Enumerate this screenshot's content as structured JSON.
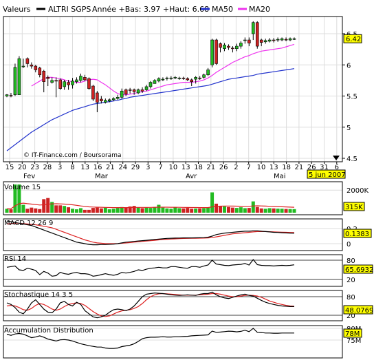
{
  "header": {
    "label": "Valeurs",
    "series_name": "ALTRI SGPS",
    "stats": "Année +Bas: 3.97 +Haut: 6.68",
    "ma50_label": "MA50",
    "ma20_label": "MA20"
  },
  "colors": {
    "background": "#ffffff",
    "axis": "#000000",
    "grid": "#dcdcdc",
    "candle_up": "#22bb22",
    "candle_down": "#cc2222",
    "candle_outline": "#000000",
    "ma50": "#2233cc",
    "ma20": "#ee33ee",
    "label_box": "#ffff00",
    "signal_line": "#dd2222",
    "indicator_line": "#000000"
  },
  "credit": "© IT-Finance.com / Boursorama",
  "date_axis": {
    "tick_labels": [
      "15",
      "20",
      "23",
      "28",
      "3",
      "8",
      "13",
      "16",
      "21",
      "24",
      "29",
      "3",
      "7",
      "10",
      "13",
      "18",
      "21",
      "26",
      "2",
      "7",
      "10",
      "13",
      "18",
      "21",
      "26",
      "31",
      "6"
    ],
    "month_labels": [
      "Fev",
      "Mar",
      "Avr",
      "Mai"
    ],
    "current_date": "5 jun 2007"
  },
  "chart_data": [
    {
      "type": "candlestick",
      "title": "ALTRI SGPS",
      "y_ticks": [
        "6.5",
        "6",
        "5.5",
        "5",
        "4.5"
      ],
      "ylim": [
        4.45,
        6.8
      ],
      "last_value": "6.42",
      "dates": [
        "15/01",
        "16/01",
        "17/01",
        "18/01",
        "19/01",
        "22/01",
        "23/01",
        "24/01",
        "25/01",
        "26/01",
        "29/01",
        "30/01",
        "31/01",
        "01/02",
        "02/02",
        "05/02",
        "06/02",
        "07/02",
        "08/02",
        "09/02",
        "12/02",
        "13/02",
        "14/02",
        "15/02",
        "16/02",
        "19/02",
        "20/02",
        "21/02",
        "22/02",
        "23/02",
        "26/02",
        "27/02",
        "28/02",
        "01/03",
        "02/03",
        "05/03",
        "06/03",
        "07/03",
        "08/03",
        "09/03",
        "12/03",
        "13/03",
        "14/03",
        "15/03",
        "16/03",
        "19/03",
        "20/03",
        "21/03",
        "22/03",
        "23/03",
        "26/03",
        "27/03",
        "28/03",
        "29/03",
        "30/03",
        "02/04",
        "03/04",
        "04/04",
        "05/04",
        "06/04",
        "09/04",
        "10/04",
        "11/04",
        "12/04",
        "13/04",
        "16/04",
        "17/04",
        "18/04",
        "19/04",
        "20/04",
        "23/04",
        "24/04",
        "25/04",
        "26/04",
        "27/04",
        "30/04",
        "01/05",
        "02/05",
        "03/05",
        "04/05",
        "07/05",
        "08/05",
        "09/05",
        "10/05",
        "11/05",
        "14/05",
        "15/05",
        "16/05",
        "17/05",
        "18/05",
        "21/05",
        "22/05",
        "23/05"
      ],
      "open": [
        5.5,
        5.51,
        5.52,
        5.52,
        5.98,
        6.1,
        6.0,
        5.98,
        5.95,
        5.9,
        5.8,
        5.72,
        5.75,
        5.76,
        5.65,
        5.72,
        5.68,
        5.73,
        5.75,
        5.8,
        5.78,
        5.66,
        5.55,
        5.45,
        5.4,
        5.42,
        5.44,
        5.46,
        5.48,
        5.6,
        5.6,
        5.6,
        5.55,
        5.6,
        5.6,
        5.65,
        5.7,
        5.74,
        5.76,
        5.78,
        5.78,
        5.79,
        5.78,
        5.79,
        5.78,
        5.76,
        5.77,
        5.79,
        5.8,
        5.84,
        6.0,
        6.4,
        6.34,
        6.26,
        6.3,
        6.27,
        6.26,
        6.3,
        6.4,
        6.4,
        6.5,
        6.68,
        6.4,
        6.37,
        6.38,
        6.4,
        6.4,
        6.4,
        6.41,
        6.4,
        6.42
      ],
      "close": [
        5.52,
        5.5,
        5.96,
        6.1,
        5.98,
        6.02,
        5.98,
        5.92,
        5.84,
        5.73,
        5.78,
        5.75,
        5.74,
        5.62,
        5.73,
        5.68,
        5.74,
        5.76,
        5.82,
        5.76,
        5.62,
        5.45,
        5.4,
        5.42,
        5.43,
        5.44,
        5.46,
        5.48,
        5.58,
        5.53,
        5.59,
        5.57,
        5.6,
        5.58,
        5.65,
        5.72,
        5.75,
        5.78,
        5.77,
        5.79,
        5.79,
        5.8,
        5.79,
        5.78,
        5.76,
        5.73,
        5.8,
        5.78,
        5.84,
        5.92,
        6.4,
        6.02,
        6.28,
        6.32,
        6.28,
        6.26,
        6.3,
        6.35,
        6.4,
        6.35,
        6.68,
        6.3,
        6.36,
        6.39,
        6.4,
        6.39,
        6.41,
        6.42,
        6.4,
        6.42,
        6.42
      ],
      "high": [
        5.53,
        5.55,
        6.02,
        6.14,
        6.1,
        6.12,
        6.04,
        6.0,
        5.97,
        5.92,
        5.83,
        5.8,
        5.8,
        5.78,
        5.76,
        5.76,
        5.79,
        5.8,
        5.86,
        5.84,
        5.8,
        5.68,
        5.58,
        5.5,
        5.46,
        5.46,
        5.48,
        5.52,
        5.62,
        5.62,
        5.63,
        5.62,
        5.62,
        5.64,
        5.68,
        5.74,
        5.77,
        5.8,
        5.8,
        5.81,
        5.82,
        5.82,
        5.81,
        5.81,
        5.8,
        5.78,
        5.82,
        5.82,
        5.86,
        5.95,
        6.42,
        6.42,
        6.36,
        6.35,
        6.33,
        6.3,
        6.34,
        6.38,
        6.44,
        6.44,
        6.7,
        6.7,
        6.42,
        6.42,
        6.43,
        6.43,
        6.44,
        6.44,
        6.44,
        6.44,
        6.44
      ],
      "low": [
        5.48,
        5.48,
        5.5,
        5.92,
        5.95,
        5.96,
        5.94,
        5.88,
        5.8,
        5.56,
        5.66,
        5.7,
        5.48,
        5.6,
        5.6,
        5.6,
        5.62,
        5.7,
        5.72,
        5.74,
        5.6,
        5.42,
        5.24,
        5.38,
        5.38,
        5.4,
        5.42,
        5.44,
        5.46,
        5.5,
        5.54,
        5.52,
        5.53,
        5.55,
        5.58,
        5.62,
        5.7,
        5.72,
        5.74,
        5.75,
        5.76,
        5.77,
        5.76,
        5.76,
        5.74,
        5.66,
        5.7,
        5.76,
        5.78,
        5.82,
        5.96,
        6.0,
        6.2,
        6.22,
        6.24,
        6.2,
        6.22,
        6.26,
        6.34,
        6.3,
        6.4,
        6.26,
        6.3,
        6.34,
        6.36,
        6.36,
        6.37,
        6.38,
        6.38,
        6.38,
        6.4
      ],
      "ma50": [
        4.62,
        4.67,
        4.72,
        4.77,
        4.82,
        4.87,
        4.92,
        4.96,
        5.0,
        5.04,
        5.08,
        5.12,
        5.15,
        5.18,
        5.21,
        5.24,
        5.27,
        5.29,
        5.31,
        5.33,
        5.35,
        5.37,
        5.38,
        5.39,
        5.4,
        5.41,
        5.42,
        5.43,
        5.45,
        5.46,
        5.48,
        5.49,
        5.5,
        5.51,
        5.52,
        5.53,
        5.54,
        5.55,
        5.56,
        5.57,
        5.58,
        5.59,
        5.6,
        5.61,
        5.62,
        5.63,
        5.64,
        5.65,
        5.66,
        5.67,
        5.69,
        5.71,
        5.73,
        5.75,
        5.77,
        5.78,
        5.79,
        5.8,
        5.81,
        5.82,
        5.83,
        5.85,
        5.86,
        5.87,
        5.88,
        5.89,
        5.9,
        5.91,
        5.92,
        5.93,
        5.94
      ],
      "ma20": [
        null,
        null,
        null,
        null,
        null,
        null,
        5.66,
        5.7,
        5.74,
        5.78,
        5.8,
        5.8,
        5.79,
        5.78,
        5.76,
        5.74,
        5.73,
        5.72,
        5.72,
        5.74,
        5.76,
        5.77,
        5.76,
        5.72,
        5.68,
        5.63,
        5.58,
        5.54,
        5.52,
        5.52,
        5.53,
        5.54,
        5.56,
        5.57,
        5.58,
        5.6,
        5.62,
        5.64,
        5.66,
        5.68,
        5.69,
        5.7,
        5.71,
        5.72,
        5.72,
        5.72,
        5.73,
        5.74,
        5.76,
        5.79,
        5.83,
        5.88,
        5.92,
        5.96,
        6.0,
        6.04,
        6.07,
        6.1,
        6.13,
        6.15,
        6.18,
        6.2,
        6.22,
        6.23,
        6.24,
        6.25,
        6.26,
        6.27,
        6.29,
        6.31,
        6.33
      ]
    },
    {
      "type": "bar",
      "title": "Volume 15",
      "y_ticks": [
        "2000K"
      ],
      "last_value": "315K",
      "ylim": [
        0,
        2500
      ],
      "values": [
        350,
        300,
        2500,
        2500,
        700,
        350,
        450,
        380,
        320,
        1200,
        1300,
        950,
        650,
        650,
        600,
        480,
        350,
        300,
        400,
        250,
        250,
        420,
        450,
        380,
        450,
        300,
        350,
        420,
        500,
        450,
        550,
        600,
        450,
        400,
        450,
        420,
        500,
        700,
        450,
        380,
        350,
        480,
        400,
        380,
        420,
        350,
        370,
        380,
        400,
        450,
        1800,
        800,
        600,
        550,
        500,
        450,
        420,
        480,
        400,
        420,
        1000,
        500,
        380,
        350,
        400,
        380,
        360,
        350,
        330,
        320,
        315
      ],
      "ma": [
        350,
        360,
        600,
        800,
        850,
        800,
        760,
        720,
        680,
        700,
        750,
        780,
        790,
        780,
        760,
        740,
        700,
        650,
        600,
        560,
        520,
        500,
        490,
        480,
        470,
        460,
        450,
        450,
        450,
        450,
        460,
        470,
        470,
        470,
        470,
        470,
        480,
        490,
        490,
        490,
        480,
        480,
        475,
        470,
        465,
        460,
        455,
        450,
        450,
        450,
        520,
        560,
        580,
        590,
        590,
        585,
        580,
        575,
        570,
        570,
        600,
        610,
        600,
        585,
        570,
        555,
        540,
        525,
        510,
        495,
        480
      ]
    },
    {
      "type": "line",
      "title": "MACD 12 26 9",
      "y_ticks": [
        "0.2",
        "0"
      ],
      "last_value": "0.1383",
      "ylim": [
        -0.05,
        0.3
      ],
      "macd": [
        0.3,
        0.29,
        0.28,
        0.27,
        0.26,
        0.25,
        0.24,
        0.22,
        0.2,
        0.18,
        0.16,
        0.14,
        0.12,
        0.1,
        0.08,
        0.06,
        0.04,
        0.02,
        0.01,
        0.0,
        -0.01,
        -0.015,
        -0.015,
        -0.012,
        -0.01,
        -0.008,
        -0.005,
        0.0,
        0.01,
        0.02,
        0.025,
        0.03,
        0.035,
        0.04,
        0.045,
        0.05,
        0.055,
        0.06,
        0.065,
        0.07,
        0.072,
        0.074,
        0.075,
        0.076,
        0.076,
        0.076,
        0.077,
        0.078,
        0.08,
        0.085,
        0.1,
        0.12,
        0.13,
        0.14,
        0.145,
        0.15,
        0.155,
        0.16,
        0.165,
        0.165,
        0.17,
        0.17,
        0.165,
        0.16,
        0.155,
        0.15,
        0.148,
        0.145,
        0.142,
        0.14,
        0.1383
      ],
      "signal": [
        0.26,
        0.265,
        0.27,
        0.27,
        0.265,
        0.26,
        0.255,
        0.25,
        0.24,
        0.23,
        0.22,
        0.21,
        0.19,
        0.17,
        0.15,
        0.13,
        0.11,
        0.09,
        0.07,
        0.05,
        0.035,
        0.02,
        0.01,
        0.005,
        0.0,
        0.0,
        0.0,
        0.002,
        0.005,
        0.01,
        0.015,
        0.02,
        0.025,
        0.03,
        0.035,
        0.04,
        0.045,
        0.05,
        0.055,
        0.058,
        0.061,
        0.064,
        0.067,
        0.069,
        0.07,
        0.071,
        0.072,
        0.073,
        0.074,
        0.076,
        0.08,
        0.09,
        0.1,
        0.11,
        0.12,
        0.13,
        0.135,
        0.14,
        0.145,
        0.15,
        0.155,
        0.16,
        0.16,
        0.16,
        0.158,
        0.156,
        0.154,
        0.152,
        0.15,
        0.148,
        0.146
      ]
    },
    {
      "type": "line",
      "title": "RSI 14",
      "y_ticks": [
        "80",
        "20"
      ],
      "last_value": "65.6932",
      "ylim": [
        0,
        100
      ],
      "values": [
        58,
        60,
        62,
        50,
        48,
        55,
        52,
        48,
        35,
        45,
        40,
        30,
        32,
        42,
        38,
        36,
        40,
        42,
        38,
        38,
        36,
        30,
        32,
        35,
        38,
        35,
        33,
        36,
        42,
        40,
        42,
        45,
        50,
        48,
        52,
        55,
        56,
        58,
        56,
        56,
        60,
        60,
        58,
        56,
        55,
        60,
        60,
        58,
        62,
        65,
        80,
        68,
        66,
        64,
        63,
        65,
        66,
        67,
        70,
        65,
        82,
        66,
        64,
        63,
        63,
        62,
        63,
        64,
        63,
        64,
        65.7
      ],
      "levels": [
        80,
        20
      ]
    },
    {
      "type": "line",
      "title": "Stochastique 14 3 5",
      "y_ticks": [
        "80",
        "20"
      ],
      "last_value": "48.0769",
      "ylim": [
        0,
        100
      ],
      "k": [
        60,
        55,
        45,
        30,
        25,
        40,
        60,
        70,
        55,
        40,
        30,
        28,
        40,
        60,
        65,
        55,
        50,
        62,
        55,
        35,
        25,
        15,
        12,
        15,
        20,
        30,
        38,
        40,
        38,
        35,
        40,
        50,
        65,
        80,
        88,
        90,
        92,
        91,
        90,
        88,
        86,
        85,
        84,
        85,
        86,
        85,
        84,
        88,
        90,
        90,
        95,
        86,
        80,
        76,
        74,
        78,
        82,
        86,
        88,
        84,
        82,
        75,
        68,
        62,
        58,
        55,
        52,
        50,
        49,
        48,
        48
      ],
      "d": [
        50,
        52,
        50,
        45,
        38,
        36,
        42,
        52,
        58,
        55,
        48,
        40,
        36,
        40,
        48,
        55,
        58,
        60,
        58,
        52,
        42,
        32,
        24,
        18,
        16,
        18,
        24,
        30,
        34,
        36,
        38,
        42,
        48,
        58,
        70,
        80,
        86,
        89,
        90,
        89,
        88,
        87,
        86,
        85,
        85,
        85,
        85,
        86,
        87,
        88,
        90,
        90,
        88,
        85,
        82,
        80,
        80,
        82,
        84,
        85,
        84,
        82,
        78,
        72,
        66,
        62,
        58,
        55,
        52,
        50,
        49
      ]
    },
    {
      "type": "line",
      "title": "Accumulation Distribution",
      "y_ticks": [
        "80M",
        "75M"
      ],
      "last_value": "78M",
      "ylim": [
        71,
        80.5
      ],
      "values": [
        77.5,
        77.0,
        77.6,
        77.8,
        77.5,
        76.8,
        76.0,
        76.3,
        76.8,
        76.2,
        75.4,
        75.0,
        74.6,
        75.1,
        75.2,
        75.0,
        74.6,
        74.0,
        73.4,
        73.0,
        72.6,
        72.3,
        72.0,
        72.0,
        71.6,
        71.4,
        71.4,
        71.6,
        72.2,
        72.5,
        72.8,
        73.4,
        74.4,
        75.6,
        76.0,
        76.2,
        76.2,
        76.3,
        76.4,
        76.3,
        76.3,
        76.4,
        76.4,
        76.5,
        76.6,
        76.8,
        76.9,
        77.0,
        77.1,
        77.2,
        78.8,
        78.3,
        78.4,
        78.6,
        78.8,
        78.7,
        78.5,
        78.7,
        79.2,
        78.6,
        80.0,
        78.3,
        78.2,
        78.0,
        78.0,
        77.9,
        77.9,
        78.0,
        78.0,
        78.0,
        78.0
      ]
    }
  ]
}
